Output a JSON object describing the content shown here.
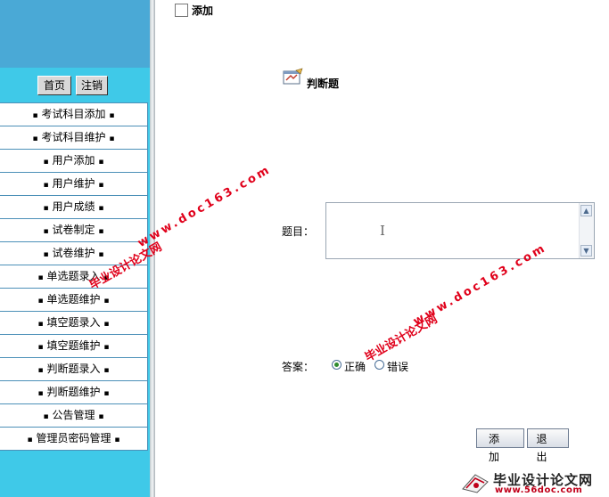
{
  "sidebar": {
    "home_label": "首页",
    "logout_label": "注销",
    "bullet": "▪",
    "items": [
      {
        "label": "考试科目添加"
      },
      {
        "label": "考试科目维护"
      },
      {
        "label": "用户添加"
      },
      {
        "label": "用户维护"
      },
      {
        "label": "用户成绩"
      },
      {
        "label": "试卷制定"
      },
      {
        "label": "试卷维护"
      },
      {
        "label": "单选题录入"
      },
      {
        "label": "单选题维护"
      },
      {
        "label": "填空题录入"
      },
      {
        "label": "填空题维护"
      },
      {
        "label": "判断题录入"
      },
      {
        "label": "判断题维护"
      },
      {
        "label": "公告管理"
      },
      {
        "label": "管理员密码管理"
      }
    ]
  },
  "main": {
    "header_title": "添加",
    "question_type": "判断题",
    "question_label": "题目：",
    "question_value": "",
    "answer_label": "答案：",
    "answer_options": [
      {
        "label": "正确",
        "checked": true
      },
      {
        "label": "错误",
        "checked": false
      }
    ],
    "add_button": "添加",
    "exit_button": "退出"
  },
  "watermarks": {
    "site_name": "毕业设计论文网",
    "url_text": "www.doc163.com",
    "footer_title": "毕业设计论文网",
    "footer_url": "www.56doc.com"
  },
  "colors": {
    "sidebar_bg": "#3fc9e8",
    "sidebar_top": "#4aa9d6",
    "watermark": "#e0001a"
  }
}
